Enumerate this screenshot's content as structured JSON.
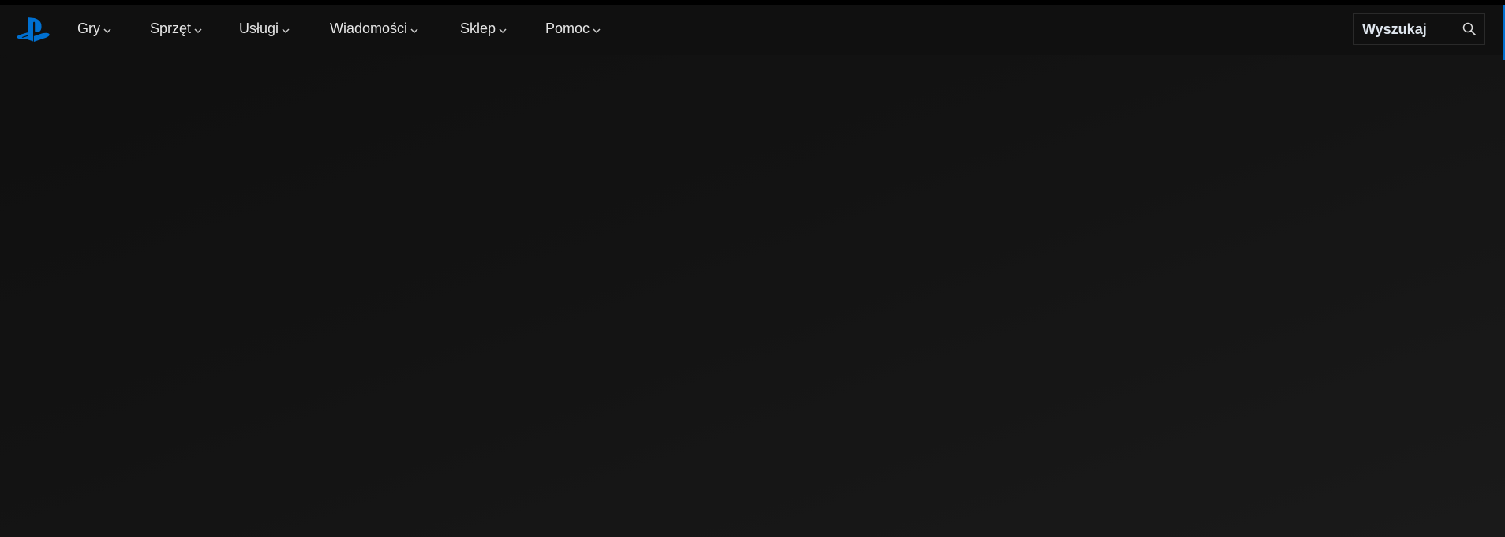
{
  "nav": {
    "items": [
      {
        "label": "Gry"
      },
      {
        "label": "Sprzęt"
      },
      {
        "label": "Usługi"
      },
      {
        "label": "Wiadomości"
      },
      {
        "label": "Sklep"
      },
      {
        "label": "Pomoc"
      }
    ],
    "search_placeholder": "Wyszukaj"
  },
  "colors": {
    "brand": "#0070d1",
    "background": "#121212"
  }
}
